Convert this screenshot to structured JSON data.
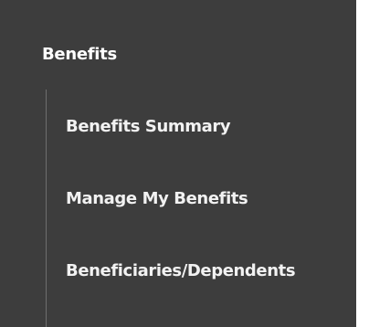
{
  "nav": {
    "section_title": "Benefits",
    "items": [
      {
        "label": "Benefits Summary"
      },
      {
        "label": "Manage My Benefits"
      },
      {
        "label": "Beneficiaries/Dependents"
      }
    ]
  },
  "colors": {
    "panel_background": "#3d3d3d",
    "text": "#ffffff",
    "tree_line": "#6e6e6e"
  }
}
